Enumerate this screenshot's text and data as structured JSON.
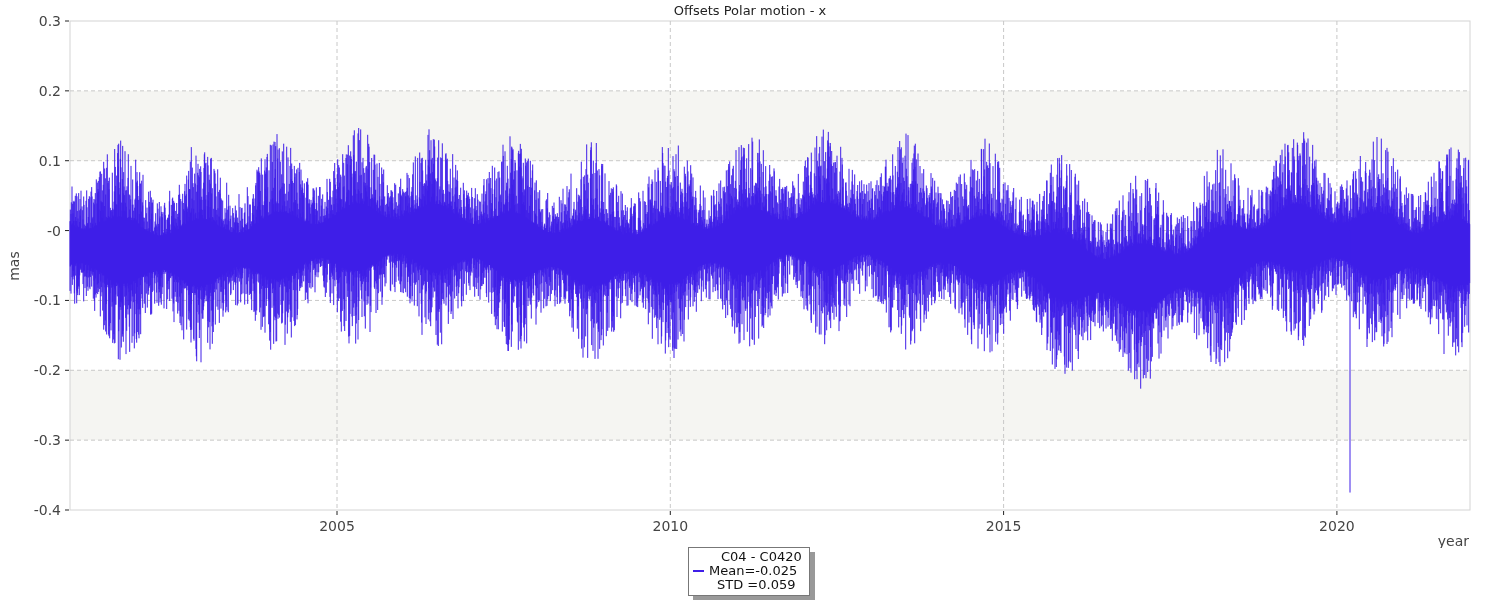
{
  "chart": {
    "title": "Offsets Polar motion - x",
    "y_axis_label": "mas",
    "x_axis_label": "year",
    "y_tick_labels": [
      "0.3",
      "0.2",
      "0.1",
      "-0",
      "-0.1",
      "-0.2",
      "-0.3",
      "-0.4"
    ],
    "x_tick_labels": [
      "2005",
      "2010",
      "2015",
      "2020"
    ],
    "legend": {
      "color": "#3f1ee8",
      "lines": [
        "C04 - C0420",
        "Mean=-0.025",
        "STD =0.059"
      ]
    }
  }
}
